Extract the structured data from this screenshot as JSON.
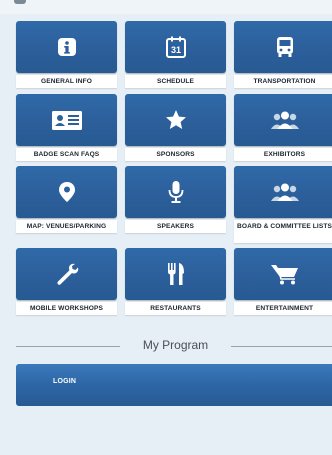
{
  "tiles": [
    {
      "label": "GENERAL INFO",
      "icon": "info-icon"
    },
    {
      "label": "SCHEDULE",
      "icon": "calendar-icon",
      "icon_text": "31"
    },
    {
      "label": "TRANSPORTATION",
      "icon": "bus-icon"
    },
    {
      "label": "BADGE SCAN FAQS",
      "icon": "badge-icon"
    },
    {
      "label": "SPONSORS",
      "icon": "star-icon"
    },
    {
      "label": "EXHIBITORS",
      "icon": "people-icon"
    },
    {
      "label": "MAP: VENUES/PARKING",
      "icon": "map-pin-icon"
    },
    {
      "label": "SPEAKERS",
      "icon": "microphone-icon"
    },
    {
      "label": "BOARD & COMMITTEE LISTS",
      "icon": "people-icon"
    },
    {
      "label": "MOBILE WORKSHOPS",
      "icon": "wrench-icon"
    },
    {
      "label": "RESTAURANTS",
      "icon": "fork-knife-icon"
    },
    {
      "label": "ENTERTAINMENT",
      "icon": "cart-icon"
    }
  ],
  "section": {
    "title": "My Program"
  },
  "login": {
    "label": "LOGIN"
  },
  "colors": {
    "tile": "#2c5f9b",
    "background": "#e6eff5",
    "label_bg": "#ffffff"
  }
}
